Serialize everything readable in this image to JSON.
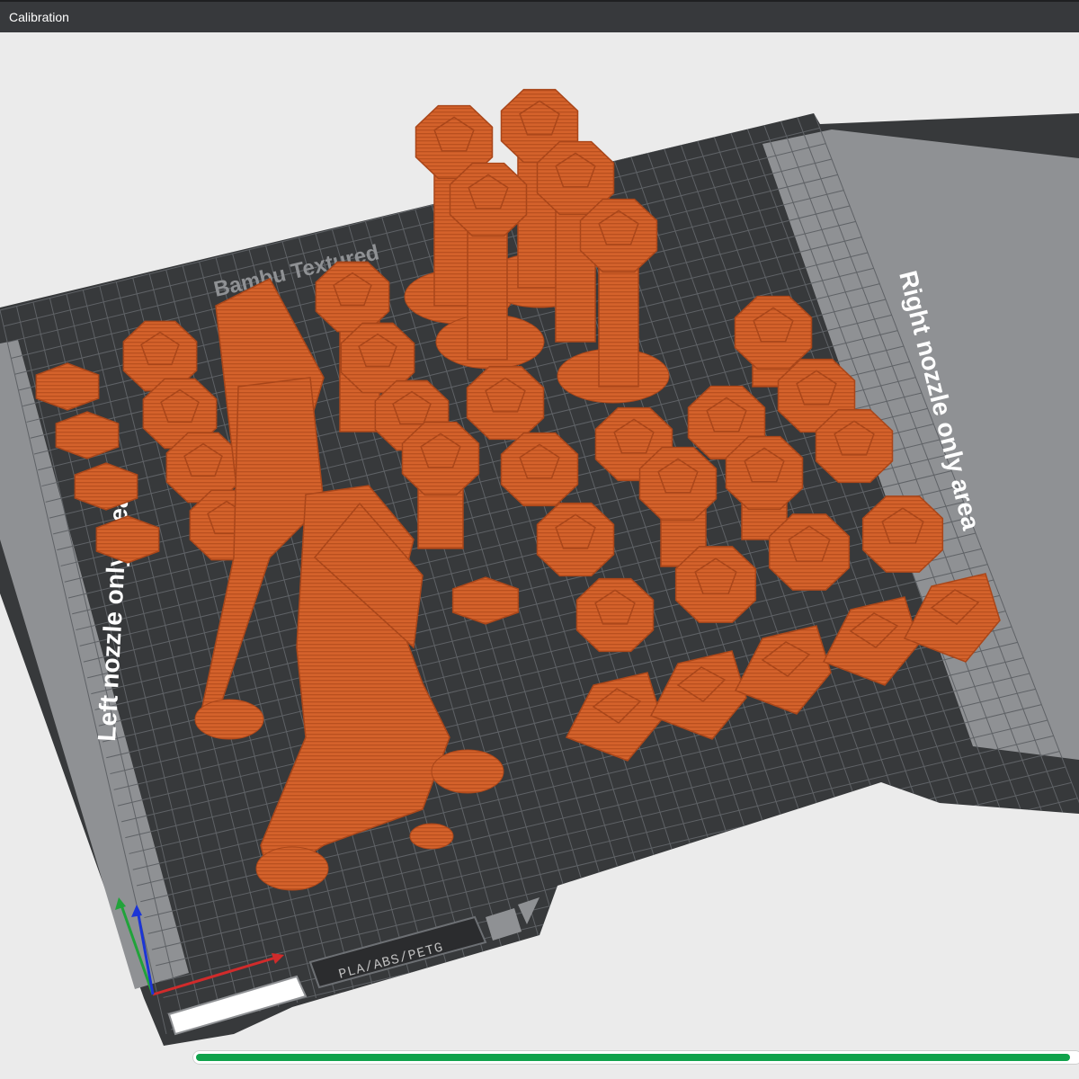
{
  "window": {
    "title": "Calibration"
  },
  "plate": {
    "left_zone_label": "Left nozzle only area",
    "right_zone_label": "Right nozzle only area",
    "material_label": "PLA/ABS/PETG",
    "plate_texture_label": "Bambu Textured",
    "plate_color": "#37393b",
    "zone_color": "#8f9194",
    "grid_color": "#5b5e62",
    "model_color": "#d4622b"
  },
  "axes": {
    "x_color": "#d12b2b",
    "y_color": "#21a33a",
    "z_color": "#1c35d6"
  },
  "progress": {
    "fraction": 0.99,
    "color": "#10a24b"
  }
}
